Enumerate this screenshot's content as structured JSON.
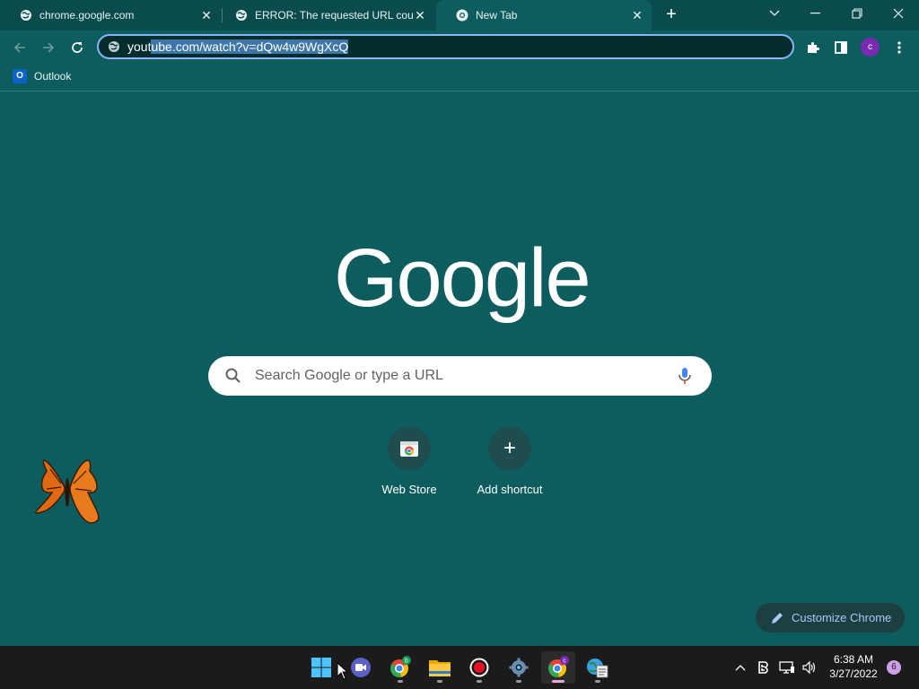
{
  "tabs": [
    {
      "title": "chrome.google.com",
      "close": "✕"
    },
    {
      "title": "ERROR: The requested URL could not be retrieved",
      "close": "✕"
    },
    {
      "title": "New Tab",
      "close": "✕"
    }
  ],
  "new_tab_symbol": "+",
  "omnibox": {
    "url_prefix": "yout",
    "url_selected": "ube.com/watch?v=dQw4w9WgXcQ"
  },
  "profile_initial": "c",
  "bookmarks": [
    {
      "label": "Outlook",
      "icon_text": "O"
    }
  ],
  "ntp": {
    "logo_text": "Google",
    "search_placeholder": "Search Google or type a URL",
    "shortcuts": [
      {
        "label": "Web Store",
        "icon": "web-store-icon"
      },
      {
        "label": "Add shortcut",
        "icon": "plus-icon",
        "symbol": "+"
      }
    ],
    "customize_label": "Customize Chrome"
  },
  "taskbar": {
    "apps": [
      {
        "name": "start",
        "icon": "windows-start-icon"
      },
      {
        "name": "meet",
        "icon": "video-meet-icon"
      },
      {
        "name": "chrome-b",
        "icon": "chrome-icon",
        "badge": "b"
      },
      {
        "name": "file-explorer",
        "icon": "folder-icon"
      },
      {
        "name": "recorder",
        "icon": "record-icon"
      },
      {
        "name": "settings",
        "icon": "gear-icon"
      },
      {
        "name": "chrome-c",
        "icon": "chrome-icon",
        "badge": "c"
      },
      {
        "name": "task-manager",
        "icon": "globe-checklist-icon"
      }
    ],
    "time": "6:38 AM",
    "date": "3/27/2022",
    "notification_count": "6"
  },
  "colors": {
    "ntp_background": "#0d5c5e",
    "omnibox_border": "#8ab4f8",
    "profile_bg": "#7b2bb3",
    "customize_text": "#a8c7fa",
    "taskbar_bg": "#1b1b1b"
  }
}
